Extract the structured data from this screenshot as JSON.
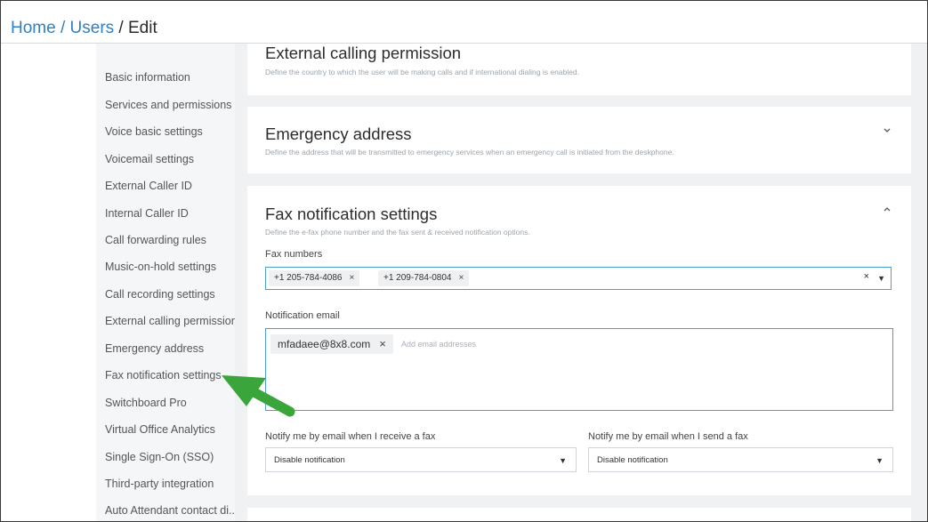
{
  "breadcrumb": {
    "home": "Home",
    "users": "Users",
    "sep1": " / ",
    "sep2": " / ",
    "current": "Edit"
  },
  "sidebar": {
    "items": [
      {
        "label": "Basic information"
      },
      {
        "label": "Services and permissions"
      },
      {
        "label": "Voice basic settings"
      },
      {
        "label": "Voicemail settings"
      },
      {
        "label": "External Caller ID"
      },
      {
        "label": "Internal Caller ID"
      },
      {
        "label": "Call forwarding rules"
      },
      {
        "label": "Music-on-hold settings"
      },
      {
        "label": "Call recording settings"
      },
      {
        "label": "External calling permission"
      },
      {
        "label": "Emergency address"
      },
      {
        "label": "Fax notification settings"
      },
      {
        "label": "Switchboard Pro"
      },
      {
        "label": "Virtual Office Analytics"
      },
      {
        "label": "Single Sign-On (SSO)"
      },
      {
        "label": "Third-party integration"
      },
      {
        "label": "Auto Attendant contact di..."
      }
    ]
  },
  "sections": {
    "external_calling": {
      "title": "External calling permission",
      "description": "Define the country to which the user will be making calls and if international dialing is enabled."
    },
    "emergency": {
      "title": "Emergency address",
      "description": "Define the address that will be transmitted to emergency services when an emergency call is initiated from the deskphone."
    },
    "fax": {
      "title": "Fax notification settings",
      "description": "Define the e-fax phone number and the fax sent & received notification options.",
      "fax_numbers_label": "Fax numbers",
      "fax_numbers": [
        "+1 205-784-4086",
        "+1 209-784-0804"
      ],
      "notification_email_label": "Notification email",
      "emails": [
        "mfadaee@8x8.com"
      ],
      "email_placeholder": "Add email addresses",
      "receive_label": "Notify me by email when I receive a fax",
      "receive_value": "Disable notification",
      "send_label": "Notify me by email when I send a fax",
      "send_value": "Disable notification"
    }
  },
  "icons": {
    "chip_remove": "×",
    "clear_all": "×",
    "dropdown_caret": "▼"
  },
  "colors": {
    "link": "#2f7fc1",
    "focus_border": "#4a9fd1",
    "arrow": "#3aa53a",
    "content_bg": "#eff1f3",
    "sidebar_bg": "#f5f6f7"
  }
}
